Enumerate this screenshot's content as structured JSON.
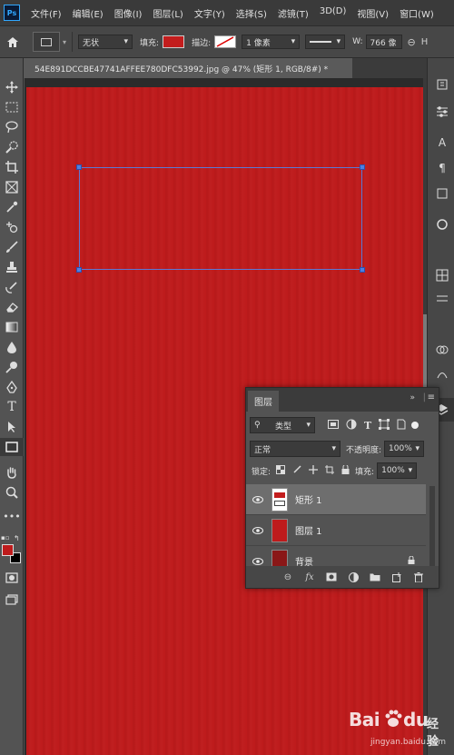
{
  "app": {
    "logo": "Ps"
  },
  "menu": [
    "文件(F)",
    "编辑(E)",
    "图像(I)",
    "图层(L)",
    "文字(Y)",
    "选择(S)",
    "滤镜(T)",
    "3D(D)",
    "视图(V)",
    "窗口(W)"
  ],
  "options": {
    "mode": "无状",
    "fill_label": "填充:",
    "fill_color": "#c31d1d",
    "stroke_label": "描边:",
    "stroke_width": "1 像素",
    "width_label": "W:",
    "width_value": "766 像"
  },
  "document": {
    "tab_title": "54E891DCCBE47741AFFEE780DFC53992.jpg @ 47% (矩形 1, RGB/8#) *",
    "canvas_color": "#be1b1c"
  },
  "colors": {
    "foreground": "#be1b1c",
    "background": "#000000",
    "selection": "#5b79d6"
  },
  "layers_panel": {
    "tab": "图层",
    "filter_kind": "类型",
    "blend_mode": "正常",
    "opacity_label": "不透明度:",
    "opacity": "100%",
    "lock_label": "锁定:",
    "fill_label": "填充:",
    "fill": "100%",
    "layers": [
      {
        "name": "矩形 1",
        "selected": true
      },
      {
        "name": "图层 1",
        "selected": false
      },
      {
        "name": "背景",
        "selected": false
      }
    ]
  },
  "watermark": {
    "brand": "Bai",
    "brand2": "du",
    "cn": "经验",
    "url": "jingyan.baidu.com"
  }
}
